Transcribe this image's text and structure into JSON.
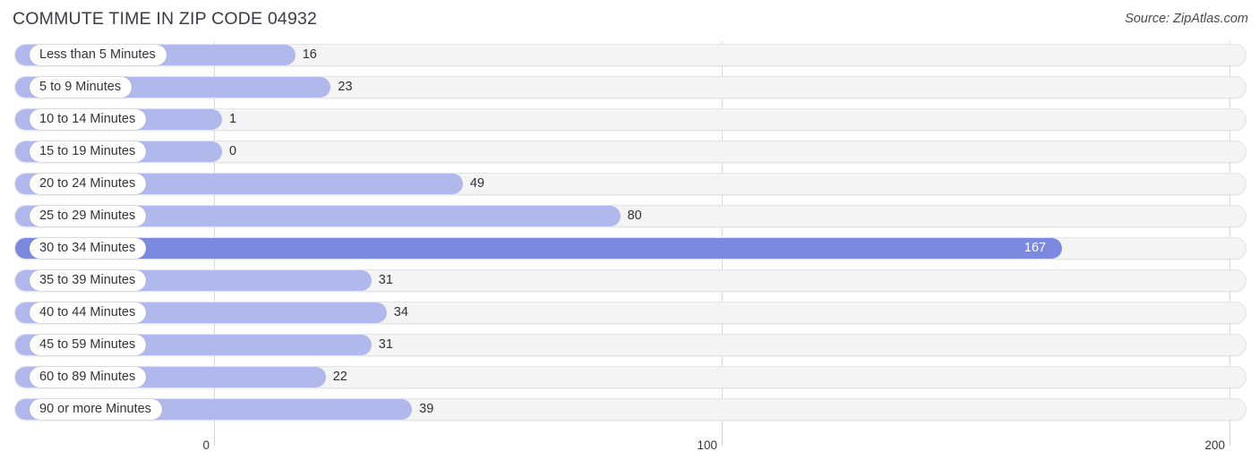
{
  "header": {
    "title": "COMMUTE TIME IN ZIP CODE 04932",
    "source": "Source: ZipAtlas.com"
  },
  "colors": {
    "bar": "#b0b8ec",
    "bar_max": "#7b8ade",
    "track": "#f4f4f5",
    "gridline": "#d8d8d8",
    "text": "#333339",
    "value_inside": "#ffffff"
  },
  "chart_data": {
    "type": "bar",
    "orientation": "horizontal",
    "title": "COMMUTE TIME IN ZIP CODE 04932",
    "xlabel": "",
    "ylabel": "",
    "xlim": [
      0,
      200
    ],
    "xticks": [
      0,
      100,
      200
    ],
    "xtick_labels": [
      "0",
      "100",
      "200"
    ],
    "grid": true,
    "legend": false,
    "categories": [
      "Less than 5 Minutes",
      "5 to 9 Minutes",
      "10 to 14 Minutes",
      "15 to 19 Minutes",
      "20 to 24 Minutes",
      "25 to 29 Minutes",
      "30 to 34 Minutes",
      "35 to 39 Minutes",
      "40 to 44 Minutes",
      "45 to 59 Minutes",
      "60 to 89 Minutes",
      "90 or more Minutes"
    ],
    "values": [
      16,
      23,
      1,
      0,
      49,
      80,
      167,
      31,
      34,
      31,
      22,
      39
    ],
    "value_labels": [
      "16",
      "23",
      "1",
      "0",
      "49",
      "80",
      "167",
      "31",
      "34",
      "31",
      "22",
      "39"
    ],
    "highlight_index": 6
  }
}
